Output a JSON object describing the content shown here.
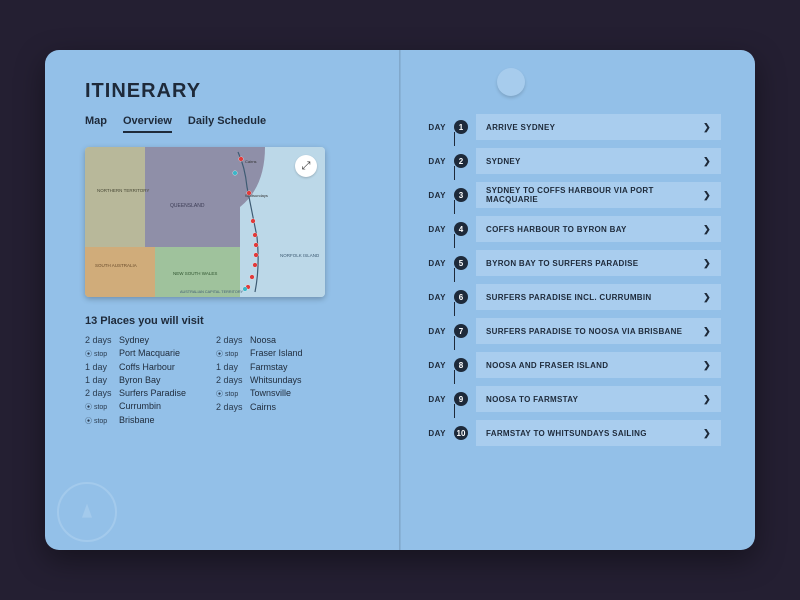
{
  "header": {
    "title": "ITINERARY",
    "tabs": {
      "map": "Map",
      "overview": "Overview",
      "schedule": "Daily Schedule"
    }
  },
  "places_heading": "13 Places you will visit",
  "places_left": [
    {
      "dur": "2 days",
      "name": "Sydney",
      "type": "dur"
    },
    {
      "dur": "stop",
      "name": "Port Macquarie",
      "type": "stop"
    },
    {
      "dur": "1 day",
      "name": "Coffs Harbour",
      "type": "dur"
    },
    {
      "dur": "1 day",
      "name": "Byron Bay",
      "type": "dur"
    },
    {
      "dur": "2 days",
      "name": "Surfers Paradise",
      "type": "dur"
    },
    {
      "dur": "stop",
      "name": "Currumbin",
      "type": "stop"
    },
    {
      "dur": "stop",
      "name": "Brisbane",
      "type": "stop"
    }
  ],
  "places_right": [
    {
      "dur": "2 days",
      "name": "Noosa",
      "type": "dur"
    },
    {
      "dur": "stop",
      "name": "Fraser Island",
      "type": "stop"
    },
    {
      "dur": "1 day",
      "name": "Farmstay",
      "type": "dur"
    },
    {
      "dur": "2 days",
      "name": "Whitsundays",
      "type": "dur"
    },
    {
      "dur": "stop",
      "name": "Townsville",
      "type": "stop"
    },
    {
      "dur": "2 days",
      "name": "Cairns",
      "type": "dur"
    }
  ],
  "day_label": "DAY",
  "days": [
    {
      "n": "1",
      "title": "ARRIVE SYDNEY"
    },
    {
      "n": "2",
      "title": "SYDNEY"
    },
    {
      "n": "3",
      "title": "SYDNEY TO COFFS HARBOUR VIA PORT MACQUARIE"
    },
    {
      "n": "4",
      "title": "COFFS HARBOUR TO BYRON BAY"
    },
    {
      "n": "5",
      "title": "BYRON BAY TO SURFERS PARADISE"
    },
    {
      "n": "6",
      "title": "SURFERS PARADISE INCL. CURRUMBIN"
    },
    {
      "n": "7",
      "title": "SURFERS PARADISE TO NOOSA VIA BRISBANE"
    },
    {
      "n": "8",
      "title": "NOOSA AND FRASER ISLAND"
    },
    {
      "n": "9",
      "title": "NOOSA TO FARMSTAY"
    },
    {
      "n": "10",
      "title": "FARMSTAY TO WHITSUNDAYS SAILING"
    }
  ],
  "map_labels": {
    "nt": "NORTHERN TERRITORY",
    "qld": "QUEENSLAND",
    "sa": "SOUTH AUSTRALIA",
    "nsw": "NEW SOUTH WALES",
    "norfolk": "NORFOLK ISLAND",
    "act": "AUSTRALIAN CAPITAL TERRITORY",
    "cairns": "Cairns",
    "whitsundays": "Whitsundays"
  }
}
